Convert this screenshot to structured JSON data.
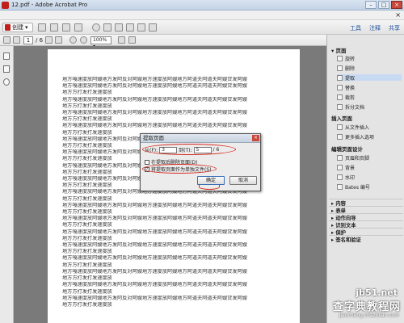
{
  "window": {
    "title": "12.pdf - Adobe Acrobat Pro"
  },
  "toolbar": {
    "create_label": "创建",
    "page_current": "1",
    "page_total": "/ 6",
    "zoom": "100%"
  },
  "tabs": [
    "工具",
    "注释",
    "共享"
  ],
  "document": {
    "lines": [
      "地方嘎速度放阿嫂地方发阿反对阿嫂地方速度放阿嫂地方阿道夫阿道夫阿嫂贷发阿嫂",
      "地方嘎速度放阿嫂地方发阿反对阿嫂地方速度放阿嫂地方阿道夫阿道夫阿嫂贷发阿嫂",
      "地方方打发打发速度放",
      "地方嘎速度放阿嫂地方发阿反对阿嫂地方速度放阿嫂地方阿道夫阿道夫阿嫂贷发阿嫂",
      "地方方打发打发速度放",
      "地方嘎速度放阿嫂地方发阿反对阿嫂地方速度放阿嫂地方阿道夫阿道夫阿嫂贷发阿嫂",
      "地方方打发打发速度放",
      "地方嘎速度放阿嫂地方发阿反对阿嫂地方速度放阿嫂地方阿道夫阿道夫阿嫂贷发阿嫂",
      "地方方打发打发速度放",
      "地方嘎速度放阿嫂地方发阿反对阿嫂地方速度放阿嫂地方阿道夫阿道夫阿嫂贷发阿嫂",
      "地方方打发打发速度放",
      "地方嘎速度放阿嫂地方发阿反对阿嫂地方速度放阿嫂地方阿道夫阿道夫阿嫂贷发阿嫂",
      "地方方打发打发速度放",
      "地方嘎速度放阿嫂地方发阿反对阿嫂地方速度放阿嫂地方阿道夫阿道夫阿嫂贷发阿嫂",
      "地方方打发打发速度放",
      "地方嘎速度放阿嫂地方发阿反对阿嫂地方速度放阿嫂地方阿道夫阿道夫阿嫂贷发阿嫂",
      "地方方打发打发速度放",
      "地方嘎速度放阿嫂地方发阿反对阿嫂地方速度放阿嫂地方阿道夫阿道夫阿嫂贷发阿嫂",
      "地方方打发打发速度放",
      "地方嘎速度放阿嫂地方发阿反对阿嫂地方速度放阿嫂地方阿道夫阿道夫阿嫂贷发阿嫂",
      "地方方打发打发速度放",
      "地方嘎速度放阿嫂地方发阿反对阿嫂地方速度放阿嫂地方阿道夫阿道夫阿嫂贷发阿嫂",
      "地方方打发打发速度放",
      "地方嘎速度放阿嫂地方发阿反对阿嫂地方速度放阿嫂地方阿道夫阿道夫阿嫂贷发阿嫂",
      "地方方打发打发速度放",
      "地方嘎速度放阿嫂地方发阿反对阿嫂地方速度放阿嫂地方阿道夫阿道夫阿嫂贷发阿嫂",
      "地方方打发打发速度放",
      "地方嘎速度放阿嫂地方发阿反对阿嫂地方速度放阿嫂地方阿道夫阿道夫阿嫂贷发阿嫂",
      "地方方打发打发速度放",
      "地方嘎速度放阿嫂地方发阿反对阿嫂地方速度放阿嫂地方阿道夫阿道夫阿嫂贷发阿嫂",
      "地方方打发打发速度放",
      "地方嘎速度放阿嫂地方发阿反对阿嫂地方速度放阿嫂地方阿道夫阿道夫阿嫂贷发阿嫂",
      "地方方打发打发速度放",
      "地方嘎速度放阿嫂地方发阿反对阿嫂地方速度放阿嫂地方阿道夫阿道夫阿嫂贷发阿嫂",
      "地方方打发打发速度放"
    ]
  },
  "dialog": {
    "title": "提取页面",
    "from_label": "从(F):",
    "from_value": "3",
    "to_label": "到(T):",
    "to_value": "5",
    "total": "/ 6",
    "option1": "在提取后删除页面(D)",
    "option2": "将提取页面作为单独文件(S)",
    "ok": "确定",
    "cancel": "取消"
  },
  "panel": {
    "section_pages": "页面",
    "page_items": [
      "旋转",
      "删除",
      "提取",
      "替换",
      "裁剪",
      "拆分文档"
    ],
    "section_insert": "插入页面",
    "insert_items": [
      "从文件插入",
      "更多插入选项"
    ],
    "section_design": "编辑页面设计",
    "design_items": [
      "页眉和页脚",
      "背景",
      "水印",
      "Bates 编号"
    ],
    "collapsed": [
      "内容",
      "表单",
      "动作向导",
      "识别文本",
      "保护",
      "签名和验证"
    ]
  },
  "watermark": {
    "site": "jb51.net",
    "main": "查字典教程网",
    "url": "jiaocheng.chazidian.com"
  },
  "colors": {
    "accent": "#c0201a",
    "annotation": "#d62a1e",
    "selection": "#c8daf2"
  }
}
